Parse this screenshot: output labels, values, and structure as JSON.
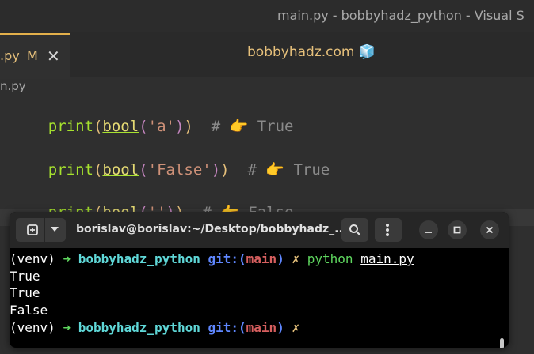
{
  "vscode": {
    "window_title": "main.py - bobbyhadz_python - Visual S",
    "tab": {
      "filename": ".py",
      "modified": "M",
      "close": "✕"
    },
    "brand": "bobbyhadz.com 🧊",
    "breadcrumb": "n.py",
    "code_lines": [
      {
        "fn": "print",
        "builtin": "bool",
        "str": "'a'",
        "comment": "# 👉 True"
      },
      {
        "fn": "print",
        "builtin": "bool",
        "str": "'False'",
        "comment": "# 👉 True"
      },
      {
        "fn": "print",
        "builtin": "bool",
        "str": "''",
        "comment": "# 👉 False"
      }
    ]
  },
  "terminal": {
    "title": "borislav@borislav:~/Desktop/bobbyhadz_...",
    "prompt": {
      "venv": "(venv)",
      "arrow": "➜",
      "dir": "bobbyhadz_python",
      "git_label": "git:(",
      "branch": "main",
      "git_close": ")",
      "dirty": "✗"
    },
    "command": "python",
    "command_arg": "main.py",
    "output": [
      "True",
      "True",
      "False"
    ]
  },
  "colors": {
    "accent": "#e3b04b",
    "function": "#a6e22e",
    "string": "#ce9178",
    "terminal_bg": "#000000"
  }
}
